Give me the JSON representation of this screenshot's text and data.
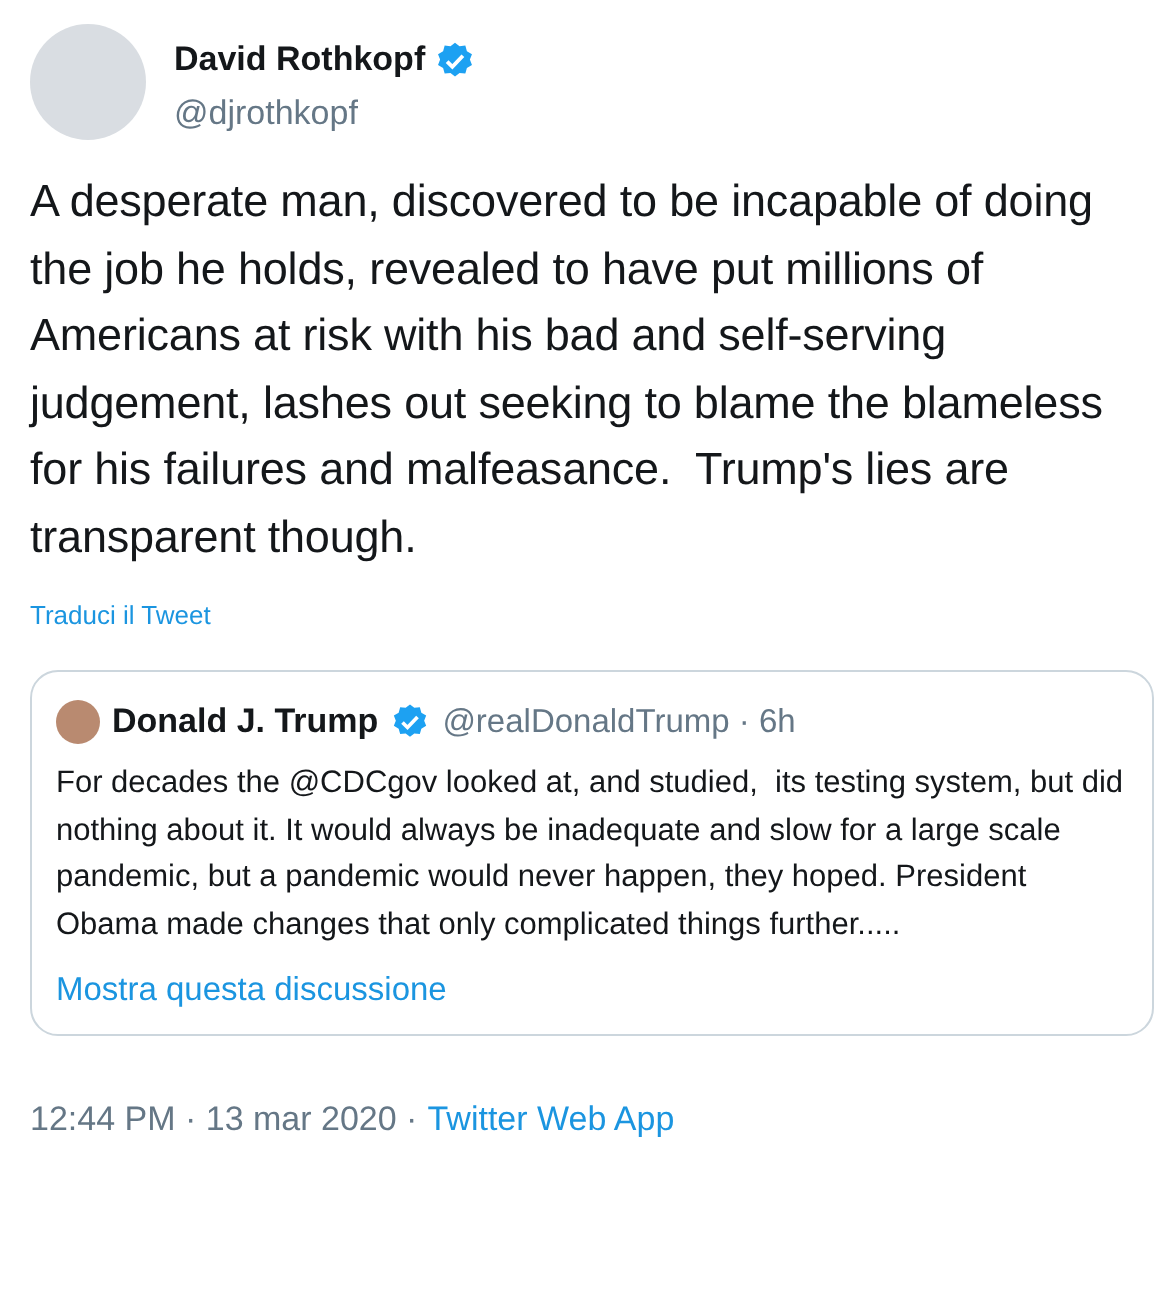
{
  "author": {
    "name": "David Rothkopf",
    "handle": "@djrothkopf",
    "verified": true
  },
  "text": "A desperate man, discovered to be incapable of doing the job he holds, revealed to have put millions of Americans at risk with his bad and self-serving judgement, lashes out seeking to blame the blameless for his failures and malfeasance.  Trump's lies are transparent though.",
  "translate_link": "Traduci il Tweet",
  "quoted": {
    "name": "Donald J. Trump",
    "verified": true,
    "meta": "@realDonaldTrump · 6h",
    "text": "For decades the @CDCgov looked at, and studied,  its testing system, but did nothing about it. It would always be inadequate and slow for a large scale pandemic, but a pandemic would never happen, they hoped. President Obama made changes that only complicated things further.....",
    "thread_link": "Mostra questa discussione"
  },
  "footer": {
    "meta": "12:44 PM · 13 mar 2020 ·",
    "source": "Twitter Web App"
  }
}
